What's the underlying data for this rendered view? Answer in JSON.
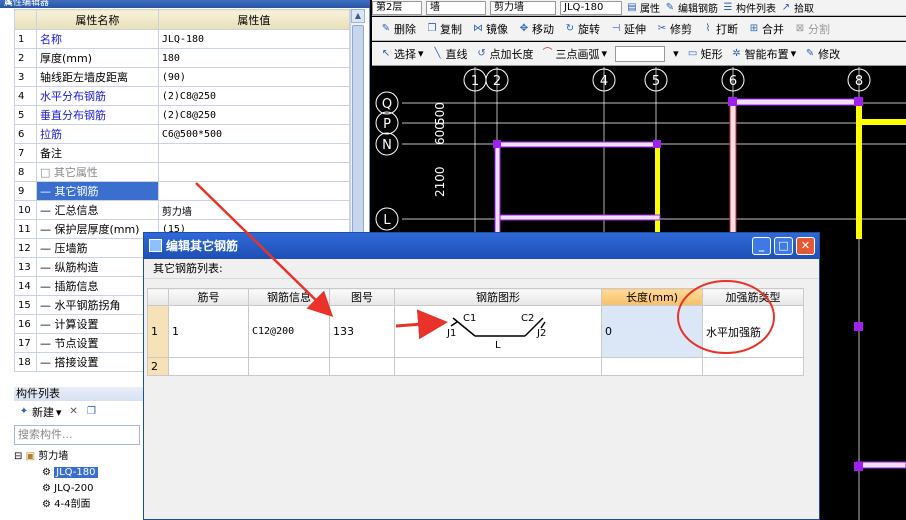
{
  "left_panel": {
    "title": "属性编辑器",
    "header_name": "属性名称",
    "header_value": "属性值",
    "rows": [
      {
        "n": "1",
        "name": "名称",
        "value": "JLQ-180",
        "cls": "blue"
      },
      {
        "n": "2",
        "name": "厚度(mm)",
        "value": "180",
        "cls": ""
      },
      {
        "n": "3",
        "name": "轴线距左墙皮距离",
        "value": "(90)",
        "cls": ""
      },
      {
        "n": "4",
        "name": "水平分布钢筋",
        "value": "(2)C8@250",
        "cls": "blue"
      },
      {
        "n": "5",
        "name": "垂直分布钢筋",
        "value": "(2)C8@250",
        "cls": "blue"
      },
      {
        "n": "6",
        "name": "拉筋",
        "value": "C6@500*500",
        "cls": "blue"
      },
      {
        "n": "7",
        "name": "备注",
        "value": "",
        "cls": ""
      },
      {
        "n": "8",
        "name": "□ 其它属性",
        "value": "",
        "cls": "gray"
      },
      {
        "n": "9",
        "name": "— 其它钢筋",
        "value": "",
        "cls": "sel"
      },
      {
        "n": "10",
        "name": "— 汇总信息",
        "value": "剪力墙",
        "cls": ""
      },
      {
        "n": "11",
        "name": "— 保护层厚度(mm)",
        "value": "(15)",
        "cls": ""
      },
      {
        "n": "12",
        "name": "— 压墙筋",
        "value": "",
        "cls": ""
      },
      {
        "n": "13",
        "name": "— 纵筋构造",
        "value": "",
        "cls": ""
      },
      {
        "n": "14",
        "name": "— 插筋信息",
        "value": "",
        "cls": ""
      },
      {
        "n": "15",
        "name": "— 水平钢筋拐角",
        "value": "",
        "cls": ""
      },
      {
        "n": "16",
        "name": "— 计算设置",
        "value": "",
        "cls": ""
      },
      {
        "n": "17",
        "name": "— 节点设置",
        "value": "",
        "cls": ""
      },
      {
        "n": "18",
        "name": "— 搭接设置",
        "value": "",
        "cls": ""
      }
    ]
  },
  "component_list": {
    "title": "构件列表",
    "new_label": "新建",
    "search_placeholder": "搜索构件...",
    "tree_root": "剪力墙",
    "items": [
      "JLQ-180",
      "JLQ-200",
      "4-4剖面"
    ]
  },
  "toolbar1": {
    "layer": "第2层",
    "type": "墙",
    "subtype": "剪力墙",
    "comp": "JLQ-180",
    "props": "属性",
    "edit_rebar": "编辑钢筋",
    "comp_list": "构件列表",
    "pick": "拾取"
  },
  "toolbar2": [
    "删除",
    "复制",
    "镜像",
    "移动",
    "旋转",
    "延伸",
    "修剪",
    "打断",
    "合并",
    "分割"
  ],
  "toolbar3": {
    "select": "选择",
    "line": "直线",
    "point_len": "点加长度",
    "arc": "三点画弧",
    "rect": "矩形",
    "smart": "智能布置",
    "modify": "修改"
  },
  "cad": {
    "axes_top": [
      "1",
      "2",
      "4",
      "5",
      "6",
      "8"
    ],
    "axes_left": [
      "Q",
      "P",
      "N",
      "L"
    ],
    "dims": [
      "600",
      "500",
      "2100"
    ]
  },
  "dialog": {
    "title": "编辑其它钢筋",
    "subtitle": "其它钢筋列表:",
    "headers": [
      "筋号",
      "钢筋信息",
      "图号",
      "钢筋图形",
      "长度(mm)",
      "加强筋类型"
    ],
    "rows": [
      {
        "n": "1",
        "bar_no": "1",
        "info": "C12@200",
        "fig_no": "133",
        "length": "0",
        "type": "水平加强筋",
        "shape": {
          "j1": "J1",
          "c1": "C1",
          "c2": "C2",
          "j2": "J2",
          "l": "L"
        }
      },
      {
        "n": "2",
        "bar_no": "",
        "info": "",
        "fig_no": "",
        "length": "",
        "type": ""
      }
    ]
  },
  "colors": {
    "annotation": "#e8322a",
    "accent": "#2f6ad8"
  }
}
